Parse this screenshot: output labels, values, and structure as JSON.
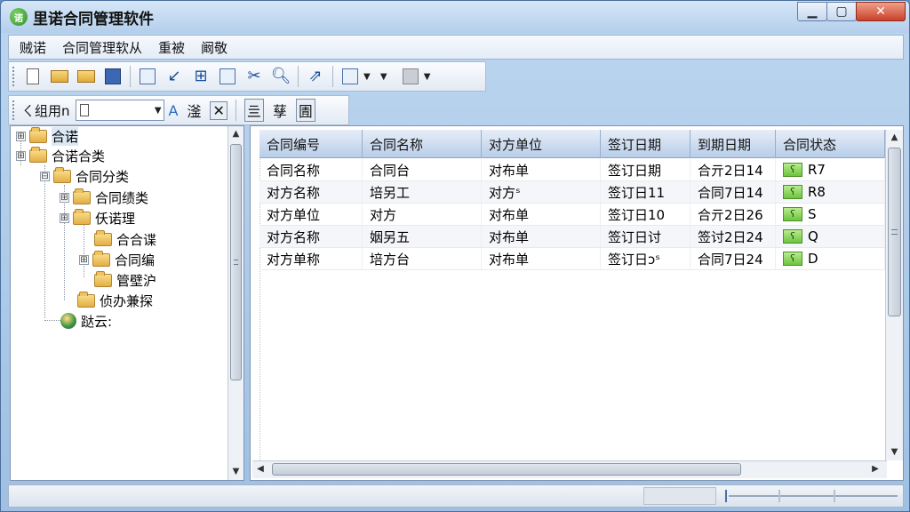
{
  "window": {
    "title": "里诺合同管理软件",
    "icon": "app-logo-icon"
  },
  "window_controls": {
    "minimize": "▁",
    "maximize": "▢",
    "close": "✕"
  },
  "menu": [
    "贼诺",
    "合同管理软从",
    "重被",
    "阚敬"
  ],
  "toolbar2": {
    "label": "ㄑ组用n"
  },
  "format_buttons": [
    "A",
    "滏",
    "✕",
    "亖",
    "孶",
    "圊"
  ],
  "tree": [
    {
      "label": "合诺",
      "expander": "⊞"
    },
    {
      "label": "合诺合类",
      "expander": "⊞"
    },
    {
      "label": "合同分类",
      "expander": "⊟"
    },
    {
      "label": "合同绩类",
      "expander": "⊞"
    },
    {
      "label": "仸诺理",
      "expander": "⊞"
    },
    {
      "label": "合合谍",
      "expander": ""
    },
    {
      "label": "合同编",
      "expander": "⊞"
    },
    {
      "label": "管壁沪",
      "expander": ""
    },
    {
      "label": "侦办兼探",
      "expander": ""
    },
    {
      "label": "跶云:",
      "expander": ""
    }
  ],
  "grid": {
    "columns": [
      "合同编号",
      "合同名称",
      "对方单位",
      "签订日期",
      "到期日期",
      "合同状态"
    ],
    "rows": [
      [
        "合同名称",
        "合同台",
        "对布单",
        "签订日期",
        "合亓2日14",
        "R7"
      ],
      [
        "对方名称",
        "培另工",
        "对方ˢ",
        "签订日11",
        "合同7日14",
        "R8"
      ],
      [
        "对方单位",
        "对方",
        "对布单",
        "签订日10",
        "合亓2日26",
        "S"
      ],
      [
        "对方名称",
        "姻另五",
        "对布单",
        "签订日讨",
        "签讨2日24",
        "Q"
      ],
      [
        "对方单称",
        "培方台",
        "对布单",
        "签订日ɔˢ",
        "合同7日24",
        "D"
      ]
    ]
  },
  "colors": {
    "titlebar": "#b4cfec",
    "header": "#b8cde8",
    "status_green": "#6cc43f",
    "close": "#c9402a"
  }
}
